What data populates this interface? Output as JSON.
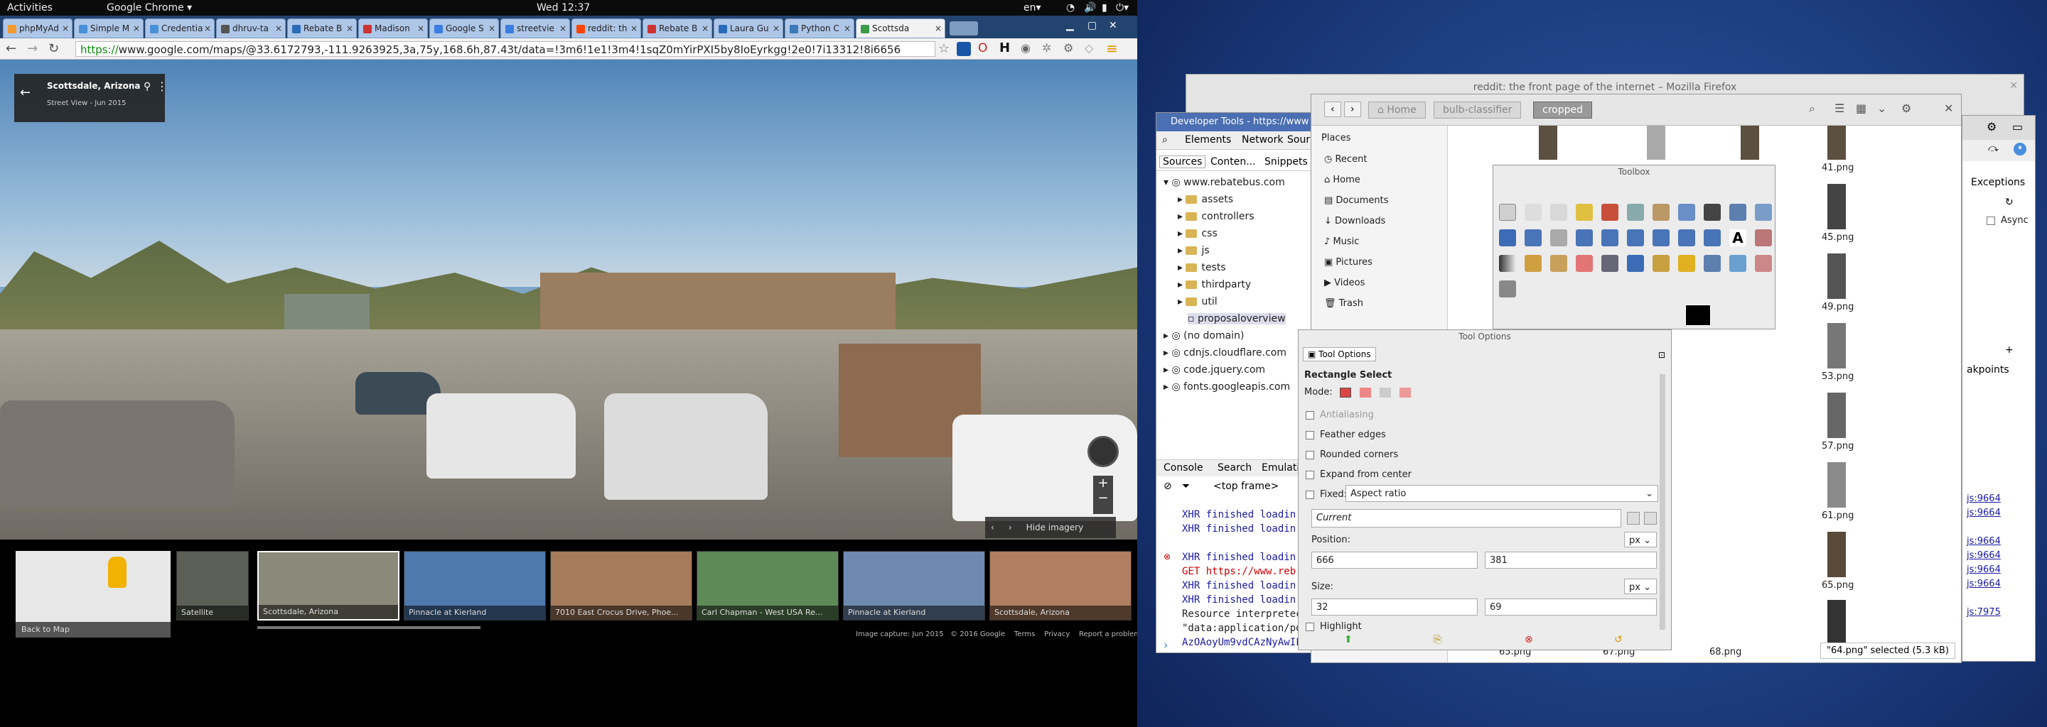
{
  "topbar": {
    "activities": "Activities",
    "app": "Google Chrome ▾",
    "clock": "Wed 12:37",
    "lang": "en▾"
  },
  "chrome": {
    "tabs": [
      "phpMyAd",
      "Simple M",
      "Credentia",
      "dhruv-ta",
      "Rebate B",
      "Madison",
      "Google S",
      "streetvie",
      "reddit: th",
      "Rebate B",
      "Laura Gu",
      "Python C",
      "Scottsda"
    ],
    "url_prefix": "https://",
    "url_rest": "www.google.com/maps/@33.6172793,-111.9263925,3a,75y,168.6h,87.43t/data=!3m6!1e1!3m4!1sqZ0mYirPXI5by8IoEyrkgg!2e0!7i13312!8i6656"
  },
  "streetview": {
    "place": "Scottsdale, Arizona",
    "date": "Street View - Jun 2015",
    "hide_imagery": "Hide imagery",
    "back_to_map": "Back to Map",
    "thumbs": [
      "Satellite",
      "Scottsdale, Arizona",
      "Pinnacle at Kierland",
      "7010 East Crocus Drive, Phoe...",
      "Carl Chapman - West USA Re...",
      "Pinnacle at Kierland",
      "Scottsdale, Arizona"
    ],
    "footer": [
      "Image capture: Jun 2015",
      "© 2016 Google",
      "Terms",
      "Privacy",
      "Report a problem"
    ]
  },
  "firefox": {
    "title": "reddit: the front page of the internet – Mozilla Firefox"
  },
  "devtools": {
    "title": "Developer Tools - https://www",
    "tabs": [
      "Elements",
      "Network",
      "Sour"
    ],
    "subtabs": [
      "Sources",
      "Conten...",
      "Snippets"
    ],
    "tree": [
      "www.rebatebus.com",
      "assets",
      "controllers",
      "css",
      "js",
      "tests",
      "thirdparty",
      "util",
      "proposaloverview",
      "(no domain)",
      "cdnjs.cloudflare.com",
      "code.jquery.com",
      "fonts.googleapis.com"
    ],
    "console_tabs": [
      "Console",
      "Search",
      "Emulatio"
    ],
    "frame": "<top frame>",
    "log": [
      "XHR finished loadin",
      "XHR finished loadin",
      "XHR finished loadin",
      "GET https://www.reb",
      "XHR finished loadin",
      "XHR finished loadin",
      "Resource interpretec",
      "\"data:application/pdf",
      "AzOAoyUm9vdCAzNyAwIFI"
    ]
  },
  "files": {
    "breadcrumbs": [
      "Home",
      "bulb-classifier",
      "cropped"
    ],
    "places_header": "Places",
    "places": [
      "Recent",
      "Home",
      "Documents",
      "Downloads",
      "Music",
      "Pictures",
      "Videos",
      "Trash"
    ],
    "thumbs": [
      "41.png",
      "45.png",
      "49.png",
      "53.png",
      "57.png",
      "61.png",
      "65.png"
    ],
    "bottom": [
      "65.png",
      "67.png",
      "68.png"
    ],
    "status": "\"64.png\" selected (5.3 kB)"
  },
  "gimp": {
    "toolbox": "Toolbox",
    "tool_options_title": "Tool Options",
    "tool_options_tab": "Tool Options",
    "tool": "Rectangle Select",
    "mode": "Mode:",
    "checks": [
      "Antialiasing",
      "Feather edges",
      "Rounded corners",
      "Expand from center"
    ],
    "fixed": "Fixed:",
    "fixed_value": "Aspect ratio",
    "current": "Current",
    "position": "Position:",
    "pos_x": "666",
    "pos_y": "381",
    "size": "Size:",
    "size_w": "32",
    "size_h": "69",
    "unit": "px",
    "highlight": "Highlight"
  },
  "rightpanel": {
    "exceptions": "Exceptions",
    "async": "Async",
    "breakpoints": "akpoints",
    "links": [
      "js:9664",
      "js:9664",
      "js:9664",
      "js:9664",
      "js:9664",
      "js:9664",
      "js:7975"
    ]
  }
}
